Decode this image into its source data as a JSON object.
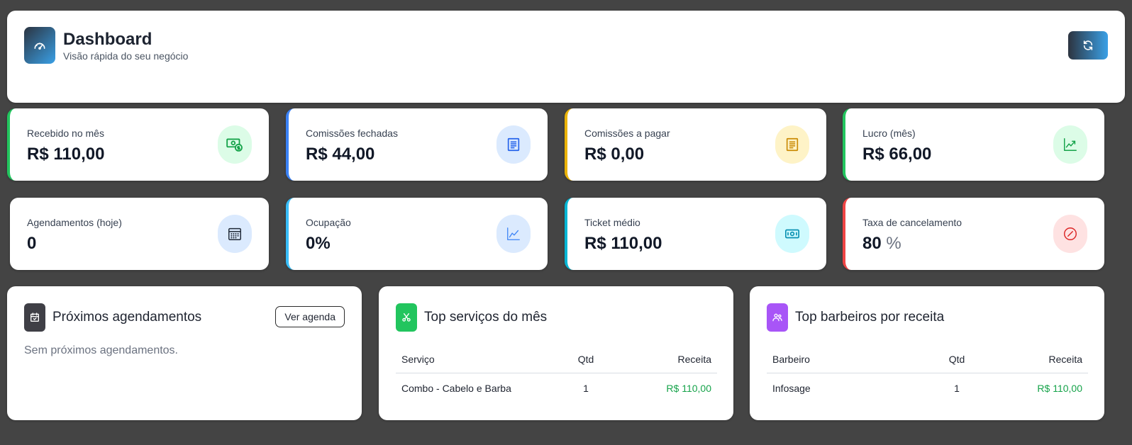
{
  "header": {
    "title": "Dashboard",
    "subtitle": "Visão rápida do seu negócio",
    "icon": "gauge-icon",
    "refresh_icon": "refresh-icon"
  },
  "kpis": [
    {
      "label": "Recebido no mês",
      "value": "R$ 110,00",
      "unit": "",
      "accent": "#22c55e",
      "icon": "cash-icon",
      "icon_bg": "#dcfce7",
      "icon_color": "#16a34a"
    },
    {
      "label": "Comissões fechadas",
      "value": "R$ 44,00",
      "unit": "",
      "accent": "#3b82f6",
      "icon": "receipt-icon",
      "icon_bg": "#dbeafe",
      "icon_color": "#2563eb"
    },
    {
      "label": "Comissões a pagar",
      "value": "R$ 0,00",
      "unit": "",
      "accent": "#eab308",
      "icon": "receipt-icon",
      "icon_bg": "#fef3c7",
      "icon_color": "#ca8a04"
    },
    {
      "label": "Lucro (mês)",
      "value": "R$ 66,00",
      "unit": "",
      "accent": "#22c55e",
      "icon": "trend-up-icon",
      "icon_bg": "#dcfce7",
      "icon_color": "#16a34a"
    },
    {
      "label": "Agendamentos (hoje)",
      "value": "0",
      "unit": "",
      "accent": "#ffffff",
      "icon": "calendar-icon",
      "icon_bg": "#dbeafe",
      "icon_color": "#1f2937"
    },
    {
      "label": "Ocupação",
      "value": "0%",
      "unit": "",
      "accent": "#38bdf8",
      "icon": "line-chart-icon",
      "icon_bg": "#dbeafe",
      "icon_color": "#3b82f6"
    },
    {
      "label": "Ticket médio",
      "value": "R$ 110,00",
      "unit": "",
      "accent": "#06b6d4",
      "icon": "money-bill-icon",
      "icon_bg": "#cffafe",
      "icon_color": "#0891b2"
    },
    {
      "label": "Taxa de cancelamento",
      "value": "80",
      "unit": " %",
      "accent": "#ef4444",
      "icon": "cancel-icon",
      "icon_bg": "#fee2e2",
      "icon_color": "#dc2626"
    }
  ],
  "upcoming": {
    "title": "Próximos agendamentos",
    "button": "Ver agenda",
    "empty": "Sem próximos agendamentos.",
    "icon": "calendar-check-icon",
    "icon_bg": "#3f3f46"
  },
  "top_services": {
    "title": "Top serviços do mês",
    "icon": "scissors-icon",
    "icon_bg": "#22c55e",
    "columns": [
      "Serviço",
      "Qtd",
      "Receita"
    ],
    "rows": [
      {
        "name": "Combo - Cabelo e Barba",
        "qty": "1",
        "revenue": "R$ 110,00"
      }
    ]
  },
  "top_barbers": {
    "title": "Top barbeiros por receita",
    "icon": "users-icon",
    "icon_bg": "#a855f7",
    "columns": [
      "Barbeiro",
      "Qtd",
      "Receita"
    ],
    "rows": [
      {
        "name": "Infosage",
        "qty": "1",
        "revenue": "R$ 110,00"
      }
    ]
  }
}
